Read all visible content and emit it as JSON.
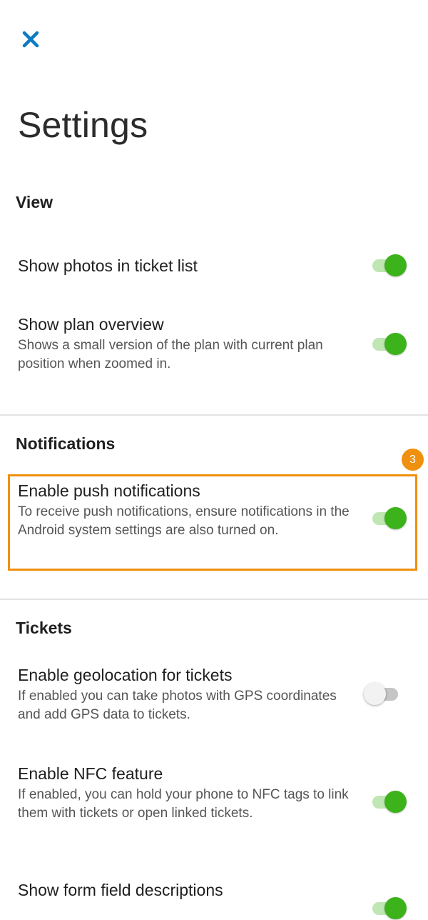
{
  "page": {
    "title": "Settings",
    "close_icon": "close-icon",
    "accent_color": "#0a7cc4"
  },
  "sections": {
    "view": {
      "title": "View",
      "items": [
        {
          "title": "Show photos in ticket list",
          "description": "",
          "enabled": true
        },
        {
          "title": "Show plan overview",
          "description": "Shows a small version of the plan with current plan position when zoomed in.",
          "enabled": true
        }
      ]
    },
    "notifications": {
      "title": "Notifications",
      "items": [
        {
          "title": "Enable push notifications",
          "description": "To receive push notifications, ensure notifications in the Android system settings are also turned on.",
          "enabled": true
        }
      ]
    },
    "tickets": {
      "title": "Tickets",
      "items": [
        {
          "title": "Enable geolocation for tickets",
          "description": "If enabled you can take photos with GPS coordinates and add GPS data to tickets.",
          "enabled": false
        },
        {
          "title": "Enable NFC feature",
          "description": "If enabled, you can hold your phone to NFC tags to link them with tickets or open linked tickets.",
          "enabled": true
        },
        {
          "title": "Show form field descriptions",
          "description": "",
          "enabled": true
        }
      ]
    }
  },
  "highlight": {
    "badge": "3",
    "color": "#f0900f"
  },
  "toggle_colors": {
    "on_knob": "#3cb31a",
    "on_track": "#bfe6b3",
    "off_knob": "#f2f2f2",
    "off_track": "#c5c5c5"
  }
}
